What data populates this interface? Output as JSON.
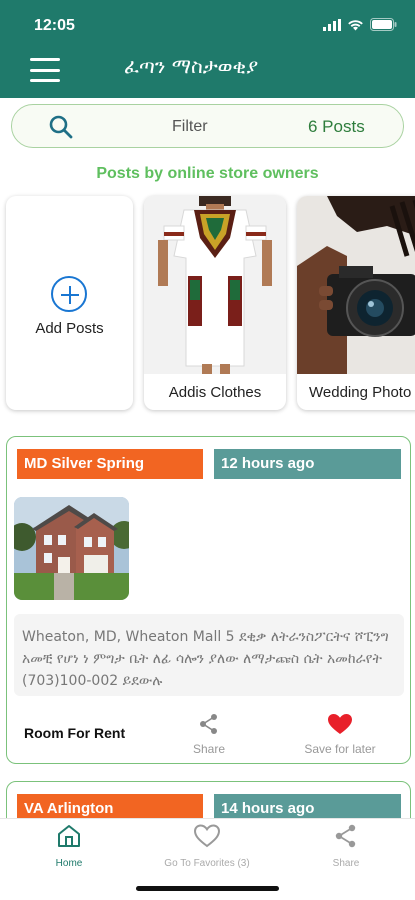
{
  "status": {
    "time": "12:05"
  },
  "header": {
    "title": "ፈጣን ማስታወቂያ"
  },
  "filter": {
    "label": "Filter",
    "count": "6 Posts"
  },
  "section_caption": "Posts by online store owners",
  "stores": {
    "add_label": "Add Posts",
    "items": [
      {
        "name": "Addis Clothes"
      },
      {
        "name": "Wedding Photo"
      }
    ]
  },
  "posts": [
    {
      "location": "MD Silver Spring",
      "time": "12 hours ago",
      "description": "Wheaton, MD, Wheaton Mall 5 ደቂቃ ለትራንስፖርትና ሾፒንግ አመቺ የሆነ ነ ምግታ ቤት ለፊ ሳሎን ያለው ለማታጩስ ሴት አመከራየት (703)100-002 ይደውሉ",
      "category": "Room For Rent",
      "share_label": "Share",
      "save_label": "Save for later"
    },
    {
      "location": "VA Arlington",
      "time": "14 hours ago"
    }
  ],
  "tabs": [
    {
      "label": "Home"
    },
    {
      "label": "Go To Favorites (3)"
    },
    {
      "label": "Share"
    }
  ],
  "colors": {
    "header": "#1f7a6b",
    "location_badge": "#f26522",
    "time_badge": "#5a9b98",
    "caption": "#5fbf5f",
    "heart": "#e8202a",
    "add_icon": "#1976d2"
  }
}
